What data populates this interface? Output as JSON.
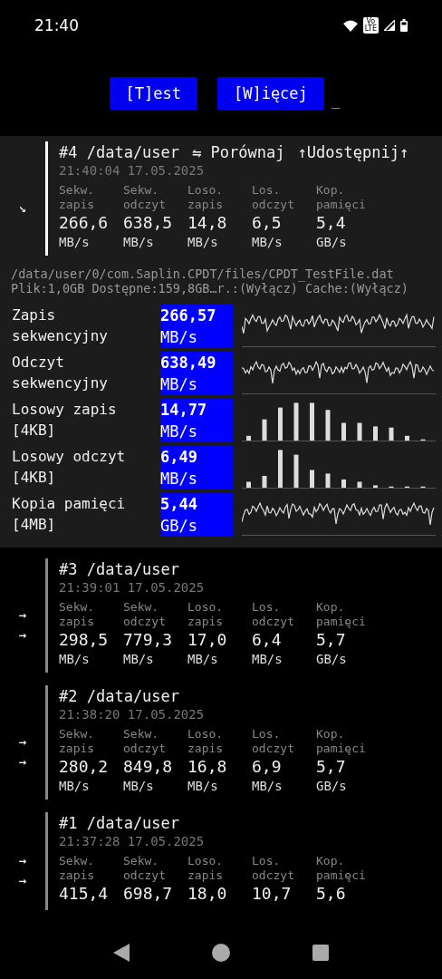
{
  "status_bar": {
    "time": "21:40",
    "volte": [
      "Vo",
      "LTE"
    ]
  },
  "toolbar": {
    "buttons": [
      "[T]est",
      "[W]ięcej"
    ],
    "cursor": "_"
  },
  "records": [
    {
      "title": "#4 /data/user",
      "selected": true,
      "markers": [
        "↘"
      ],
      "timestamp": "21:40:04 17.05.2025",
      "actions": [
        "⇋ Porównaj",
        "↑Udostępnij↑"
      ],
      "metrics": [
        {
          "label": "Sekw.\nzapis",
          "value": "266,6",
          "unit": "MB/s"
        },
        {
          "label": "Sekw.\nodczyt",
          "value": "638,5",
          "unit": "MB/s"
        },
        {
          "label": "Loso.\nzapis",
          "value": "14,8",
          "unit": "MB/s"
        },
        {
          "label": "Los.\nodczyt",
          "value": "6,5",
          "unit": "MB/s"
        },
        {
          "label": "Kop.\npamięci",
          "value": "5,4",
          "unit": "GB/s"
        }
      ],
      "details": {
        "path": "/data/user/0/com.Saplin.CPDT/files/CPDT_TestFile.dat",
        "info": "Plik:1,0GB Dostępne:159,8GB…r.:(Wyłącz) Cache:(Wyłącz)",
        "rows": [
          {
            "label": "Zapis\nsekwencyjny",
            "value": "266,57",
            "unit": "MB/s",
            "kind": "line"
          },
          {
            "label": "Odczyt\nsekwencyjny",
            "value": "638,49",
            "unit": "MB/s",
            "kind": "line"
          },
          {
            "label": "Losowy zapis\n[4KB]",
            "value": "14,77",
            "unit": "MB/s",
            "kind": "bars"
          },
          {
            "label": "Losowy odczyt\n[4KB]",
            "value": "6,49",
            "unit": "MB/s",
            "kind": "bars"
          },
          {
            "label": "Kopia pamięci\n[4MB]",
            "value": "5,44",
            "unit": "GB/s",
            "kind": "line"
          }
        ]
      }
    },
    {
      "title": "#3 /data/user",
      "selected": false,
      "markers": [
        "→",
        "→"
      ],
      "timestamp": "21:39:01 17.05.2025",
      "metrics": [
        {
          "label": "Sekw.\nzapis",
          "value": "298,5",
          "unit": "MB/s"
        },
        {
          "label": "Sekw.\nodczyt",
          "value": "779,3",
          "unit": "MB/s"
        },
        {
          "label": "Loso.\nzapis",
          "value": "17,0",
          "unit": "MB/s"
        },
        {
          "label": "Los.\nodczyt",
          "value": "6,4",
          "unit": "MB/s"
        },
        {
          "label": "Kop.\npamięci",
          "value": "5,7",
          "unit": "GB/s"
        }
      ]
    },
    {
      "title": "#2 /data/user",
      "selected": false,
      "markers": [
        "→",
        "→"
      ],
      "timestamp": "21:38:20 17.05.2025",
      "metrics": [
        {
          "label": "Sekw.\nzapis",
          "value": "280,2",
          "unit": "MB/s"
        },
        {
          "label": "Sekw.\nodczyt",
          "value": "849,8",
          "unit": "MB/s"
        },
        {
          "label": "Loso.\nzapis",
          "value": "16,8",
          "unit": "MB/s"
        },
        {
          "label": "Los.\nodczyt",
          "value": "6,9",
          "unit": "MB/s"
        },
        {
          "label": "Kop.\npamięci",
          "value": "5,7",
          "unit": "GB/s"
        }
      ]
    },
    {
      "title": "#1 /data/user",
      "selected": false,
      "markers": [
        "→",
        "→"
      ],
      "timestamp": "21:37:28 17.05.2025",
      "metrics": [
        {
          "label": "Sekw.\nzapis",
          "value": "415,4"
        },
        {
          "label": "Sekw.\nodczyt",
          "value": "698,7"
        },
        {
          "label": "Loso.\nzapis",
          "value": "18,0"
        },
        {
          "label": "Los.\nodczyt",
          "value": "10,7"
        },
        {
          "label": "Kop.\npamięci",
          "value": "5,6"
        }
      ]
    }
  ]
}
